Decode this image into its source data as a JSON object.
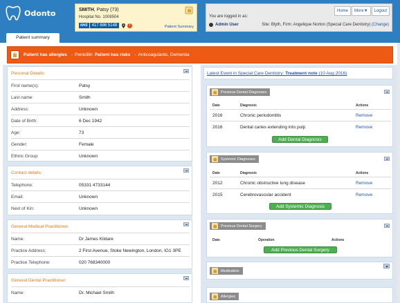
{
  "app": {
    "name": "Odonto"
  },
  "patient": {
    "name_bold": "SMITH",
    "name_rest": ", Patsy (73)",
    "hospital_no": "Hospital No. 1008504",
    "nhs_logo": "NHS",
    "nhs_number": "417 886 5148",
    "summary_link": "Patient Summary"
  },
  "topnav": [
    "Home",
    "More▼",
    "Logout"
  ],
  "login": {
    "logged_in_text": "You are logged in as:",
    "user": "Admin User",
    "site_prefix": "Site: Blyth, Firm: Angelique Norton (Special Care Dentistry)",
    "change": "(Change)"
  },
  "tabs": {
    "patient_summary": "Patient summary"
  },
  "alert": {
    "allergies_label": "Patient has allergies",
    "allergies_value": "Penicillin",
    "risks_label": "Patient has risks",
    "risks_value": "Anticoagulants, Dementia"
  },
  "personal": {
    "heading": "Personal Details:",
    "rows": [
      {
        "k": "First name(s):",
        "v": "Patsy"
      },
      {
        "k": "Last name:",
        "v": "Smith"
      },
      {
        "k": "Address:",
        "v": "Unknown"
      },
      {
        "k": "Date of Birth:",
        "v": "6 Dec 1942"
      },
      {
        "k": "Age:",
        "v": "73"
      },
      {
        "k": "Gender:",
        "v": "Female"
      },
      {
        "k": "Ethnic Group:",
        "v": "Unknown"
      }
    ]
  },
  "contact": {
    "heading": "Contact details:",
    "rows": [
      {
        "k": "Telephone:",
        "v": "05331 4733144"
      },
      {
        "k": "Email:",
        "v": "Unknown"
      },
      {
        "k": "Next of Kin:",
        "v": "Unknown"
      }
    ]
  },
  "gmp": {
    "heading": "General Medical Practitioner:",
    "rows": [
      {
        "k": "Name:",
        "v": "Dr James Kildare"
      },
      {
        "k": "Practice Address:",
        "v": "2 First Avenue, Stoke Newington, London, IG1 3PE"
      },
      {
        "k": "Practice Telephone:",
        "v": "020 768340000"
      }
    ]
  },
  "gdp": {
    "heading": "General Dental Practitioner:",
    "rows": [
      {
        "k": "Name:",
        "v": "Dr. Michael Smith"
      }
    ]
  },
  "latest_event": {
    "prefix": "Latest Event in Special Care Dentistry: ",
    "bold": "Treatment note",
    "date": " (10 Aug 2016)"
  },
  "dental_diagnoses": {
    "title": "Previous Dental Diagnoses",
    "headers": [
      "Date",
      "Diagnosis",
      "Actions"
    ],
    "rows": [
      {
        "date": "2016",
        "diagnosis": "Chronic periodontitis",
        "action": "Remove"
      },
      {
        "date": "2016",
        "diagnosis": "Dental caries extending into pulp",
        "action": "Remove"
      }
    ],
    "add_button": "Add Dental Diagnosis"
  },
  "systemic": {
    "title": "Systemic Diagnoses",
    "headers": [
      "Date",
      "Diagnosis",
      "Actions"
    ],
    "rows": [
      {
        "date": "2012",
        "diagnosis": "Chronic obstructive lung disease",
        "action": "Remove"
      },
      {
        "date": "2015",
        "diagnosis": "Cerebrovascular accident",
        "action": "Remove"
      }
    ],
    "add_button": "Add Systemic Diagnosis"
  },
  "dental_surgery": {
    "title": "Previous Dental Surgery",
    "headers": [
      "Date",
      "Operation",
      "Actions"
    ],
    "add_button": "Add Previous Dental Surgery"
  },
  "medication": {
    "title": "Medication"
  },
  "allergies": {
    "title": "Allergies"
  },
  "colors": {
    "header_blue": "#2e7fc2",
    "alert_orange": "#ee5a13",
    "green": "#4caf50",
    "link": "#1a56b0"
  }
}
